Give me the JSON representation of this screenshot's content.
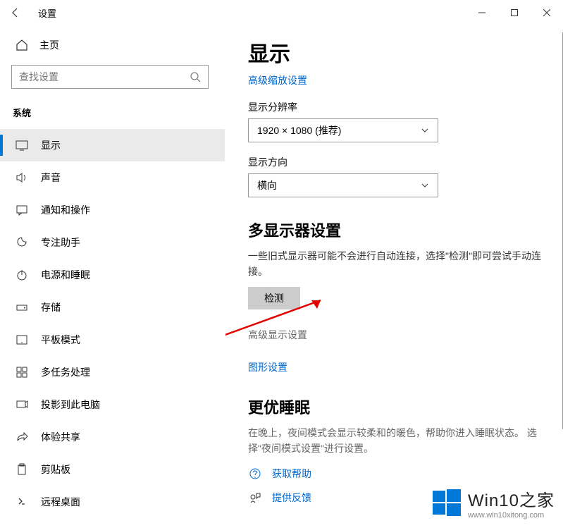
{
  "window": {
    "title": "设置"
  },
  "sidebar": {
    "home": "主页",
    "search_placeholder": "查找设置",
    "section": "系统",
    "items": [
      {
        "label": "显示"
      },
      {
        "label": "声音"
      },
      {
        "label": "通知和操作"
      },
      {
        "label": "专注助手"
      },
      {
        "label": "电源和睡眠"
      },
      {
        "label": "存储"
      },
      {
        "label": "平板模式"
      },
      {
        "label": "多任务处理"
      },
      {
        "label": "投影到此电脑"
      },
      {
        "label": "体验共享"
      },
      {
        "label": "剪贴板"
      },
      {
        "label": "远程桌面"
      }
    ]
  },
  "main": {
    "title": "显示",
    "adv_scale_link": "高级缩放设置",
    "resolution_label": "显示分辨率",
    "resolution_value": "1920 × 1080 (推荐)",
    "orientation_label": "显示方向",
    "orientation_value": "横向",
    "multi_title": "多显示器设置",
    "multi_desc": "一些旧式显示器可能不会进行自动连接，选择\"检测\"即可尝试手动连接。",
    "detect_btn": "检测",
    "adv_display": "高级显示设置",
    "graphics_link": "图形设置",
    "sleep_title": "更优睡眠",
    "sleep_desc": "在晚上，夜间模式会显示较柔和的暖色，帮助你进入睡眠状态。 选择\"夜间模式设置\"进行设置。",
    "help_link": "获取帮助",
    "feedback_link": "提供反馈"
  },
  "watermark": {
    "title": "Win10之家",
    "url": "www.win10xitong.com"
  }
}
